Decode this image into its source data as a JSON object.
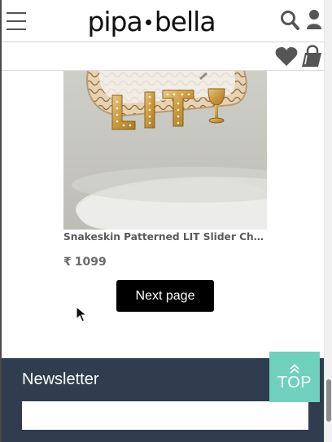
{
  "header": {
    "logo_left": "pipa",
    "logo_right": "bella",
    "menu_icon": "hamburger-menu-icon",
    "search_icon": "search-icon",
    "account_icon": "user-icon"
  },
  "subbar": {
    "wishlist_icon": "heart-icon",
    "cart_icon": "shopping-bag-icon"
  },
  "product": {
    "image_alt": "LIT slider charm bracelet",
    "title": "Snakeskin Patterned LIT Slider Charm Bracelet",
    "currency": "₹",
    "price": "1099"
  },
  "pagination": {
    "next_label": "Next page"
  },
  "footer": {
    "newsletter_title": "Newsletter",
    "newsletter_placeholder": ""
  },
  "back_to_top": {
    "label": "TOP",
    "icon": "double-chevron-up-icon"
  },
  "colors": {
    "footer_bg": "#2f3d4e",
    "top_button": "#6fd1bd",
    "next_button": "#000000"
  }
}
